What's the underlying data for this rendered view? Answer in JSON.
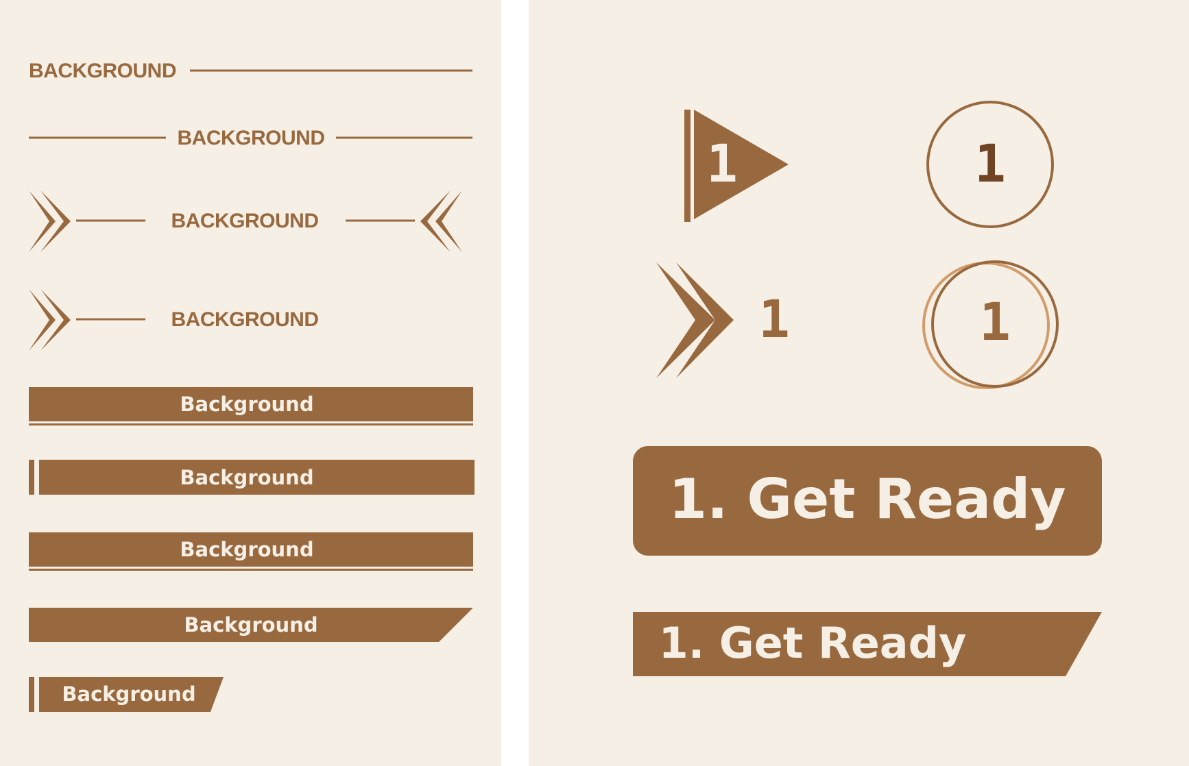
{
  "colors": {
    "background": "#f6efe5",
    "primary": "#98693f",
    "dark": "#6f4424",
    "light_ring": "#d29c6a",
    "text_light": "#f6efe5"
  },
  "left_panel": {
    "heading_1": "BACKGROUND",
    "heading_2": "BACKGROUND",
    "heading_3": "BACKGROUND",
    "heading_4": "BACKGROUND",
    "bar_1": "Background",
    "bar_2": "Background",
    "bar_3": "Background",
    "bar_4": "Background",
    "bar_5": "Background"
  },
  "right_panel": {
    "flag_number": "1",
    "circle_number": "1",
    "chevron_number": "1",
    "double_circle_number": "1",
    "rounded_title": "1. Get Ready",
    "slanted_title": "1. Get Ready"
  },
  "icons": [
    "double-chevron-right-icon",
    "double-chevron-left-icon",
    "flag-icon",
    "circle-icon"
  ]
}
